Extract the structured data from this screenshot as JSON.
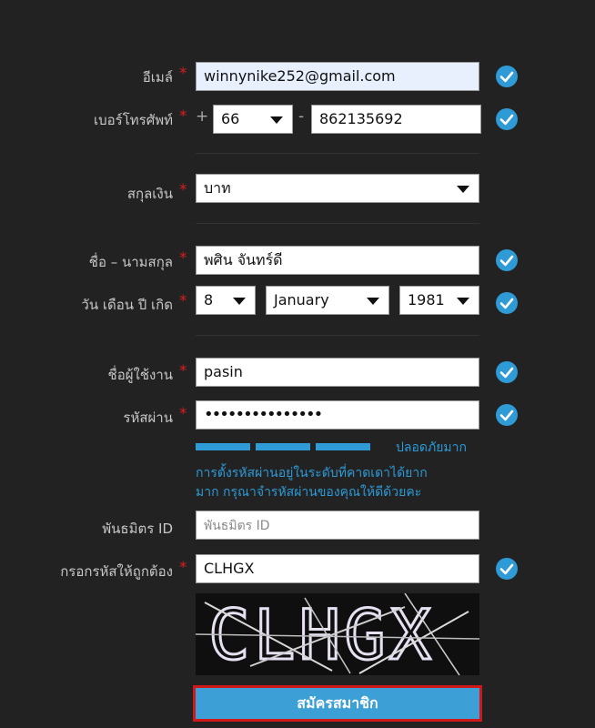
{
  "form": {
    "email": {
      "label": "อีเมล์",
      "value": "winnynike252@gmail.com"
    },
    "phone": {
      "label": "เบอร์โทรศัพท์",
      "plus": "+",
      "country_code": "66",
      "dash": "-",
      "number": "862135692"
    },
    "currency": {
      "label": "สกุลเงิน",
      "value": "บาท"
    },
    "fullname": {
      "label": "ชื่อ – นามสกุล",
      "value": "พศิน จันทร์ดี"
    },
    "birthdate": {
      "label": "วัน เดือน ปี เกิด",
      "day": "8",
      "month": "January",
      "year": "1981"
    },
    "username": {
      "label": "ชื่อผู้ใช้งาน",
      "value": "pasin"
    },
    "password": {
      "label": "รหัสผ่าน",
      "masked": "•••••••••••••••"
    },
    "strength": {
      "text": "ปลอดภัยมาก",
      "message_line1": "การตั้งรหัสผ่านอยู่ในระดับที่คาดเดาได้ยาก",
      "message_line2": "มาก กรุณาจำรหัสผ่านของคุณให้ดีด้วยคะ",
      "level_fraction": 1.0
    },
    "partner": {
      "label": "พันธมิตร ID",
      "placeholder": "พันธมิตร ID"
    },
    "captcha": {
      "label": "กรอกรหัสให้ถูกต้อง",
      "value": "CLHGX",
      "image_text": "CLHGX"
    },
    "required_mark": "*",
    "submit_label": "สมัครสมาชิก"
  },
  "colors": {
    "accent": "#2e9ad6",
    "required": "#d81e1e",
    "background": "#222222"
  },
  "icons": {
    "valid": "check-circle-icon",
    "dropdown": "caret-down-icon"
  }
}
